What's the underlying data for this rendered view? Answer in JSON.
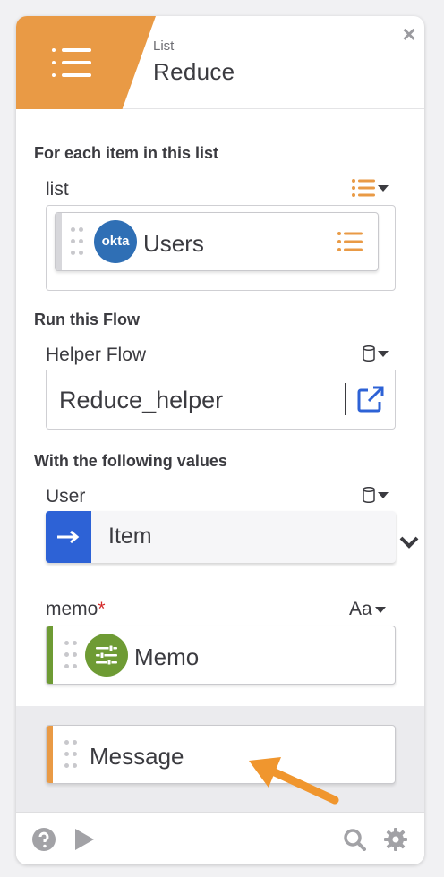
{
  "card": {
    "category": "List",
    "title": "Reduce",
    "close_symbol": "×"
  },
  "list_section": {
    "heading": "For each item in this list",
    "field_label": "list",
    "type_icon": "list-icon",
    "value": {
      "app_logo_text": "okta",
      "label": "Users",
      "type_icon": "list-icon"
    }
  },
  "flow_section": {
    "heading": "Run this Flow",
    "field_label": "Helper Flow",
    "type_icon": "database-icon",
    "value": "Reduce_helper",
    "stripe_colors": [
      "#6e9b34",
      "#9cc36b",
      "#7eb6d9"
    ]
  },
  "values_section": {
    "heading": "With the following values",
    "user": {
      "label": "User",
      "type_icon": "database-icon",
      "value": "Item"
    },
    "memo": {
      "label": "memo",
      "required_mark": "*",
      "type_label": "Aa",
      "value": "Memo"
    }
  },
  "output": {
    "label": "Message"
  },
  "footer": {
    "help_icon": "help-icon",
    "play_icon": "play-icon",
    "search_icon": "search-icon",
    "settings_icon": "gear-icon"
  },
  "colors": {
    "accent_orange": "#e99a45",
    "okta_blue": "#2f6fb5",
    "memo_green": "#6e9b34",
    "arrow_blue": "#2d62d6",
    "link_blue": "#2d62d6",
    "annotation_orange": "#f0962e"
  }
}
